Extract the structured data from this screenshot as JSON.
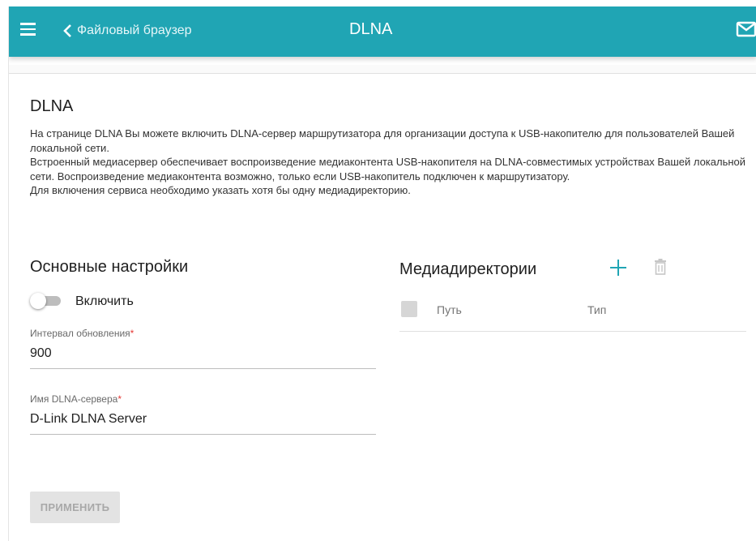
{
  "header": {
    "back_label": "Файловый браузер",
    "title": "DLNA",
    "background_color": "#20a5b4",
    "icons": [
      "menu-icon",
      "back-chevron-icon",
      "mail-icon"
    ]
  },
  "page": {
    "title": "DLNA",
    "description": [
      "На странице DLNA Вы можете включить DLNA-сервер маршрутизатора для организации доступа к USB-накопителю для пользователей Вашей локальной сети.",
      "Встроенный медиасервер обеспечивает воспроизведение медиаконтента USB-накопителя на DLNA-совместимых устройствах Вашей локальной сети. Воспроизведение медиаконтента возможно, только если USB-накопитель подключен к маршрутизатору.",
      "Для включения сервиса необходимо указать хотя бы одну медиадиректорию."
    ]
  },
  "basic_settings": {
    "title": "Основные настройки",
    "enable_label": "Включить",
    "enable_state": "off",
    "update_interval": {
      "label": "Интервал обновления",
      "required_mark": "*",
      "value": "900"
    },
    "server_name": {
      "label": "Имя DLNA-сервера",
      "required_mark": "*",
      "value": "D-Link DLNA Server"
    }
  },
  "media_dirs": {
    "title": "Медиадиректории",
    "icons": [
      "add-icon",
      "delete-icon"
    ],
    "columns": [
      "Путь",
      "Тип"
    ],
    "rows": []
  },
  "actions": {
    "apply_label": "ПРИМЕНИТЬ",
    "apply_enabled": false
  }
}
